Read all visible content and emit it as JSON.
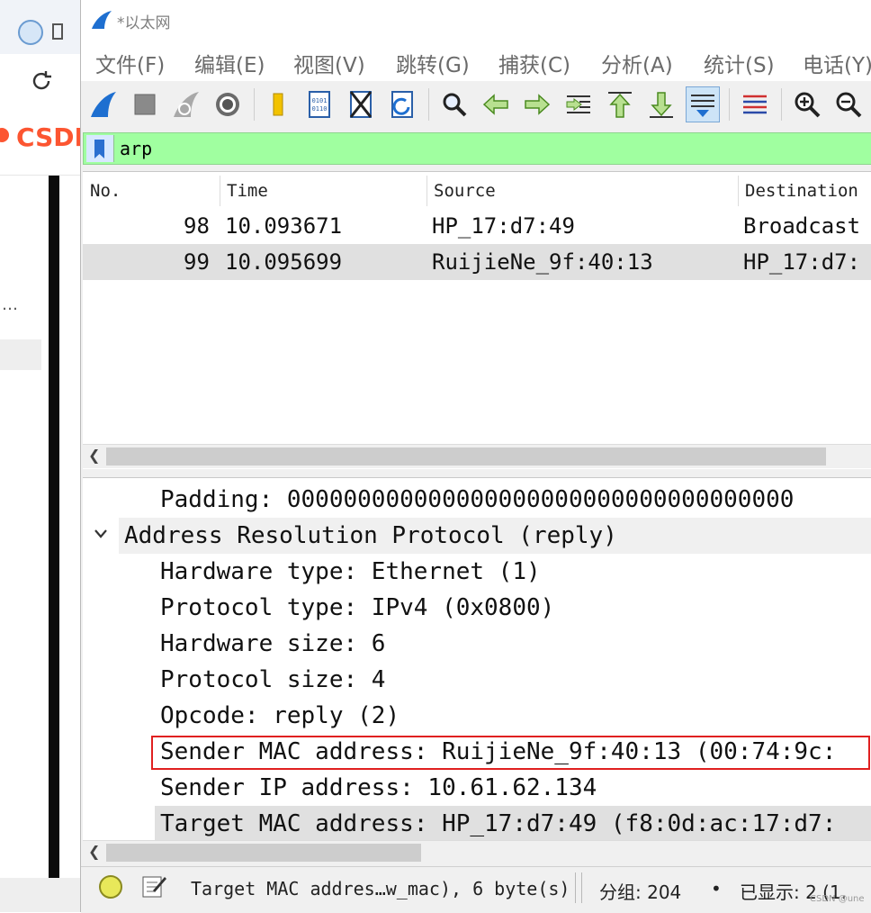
{
  "background_window": {
    "brand": "CSDN",
    "ellipsis": "…"
  },
  "window": {
    "title": "*以太网"
  },
  "menu": [
    "文件(F)",
    "编辑(E)",
    "视图(V)",
    "跳转(G)",
    "捕获(C)",
    "分析(A)",
    "统计(S)",
    "电话(Y)"
  ],
  "toolbar_icons": [
    "shark-fin-start-icon",
    "stop-square-icon",
    "shark-fin-restart-icon",
    "gear-icon",
    "folder-icon",
    "file-binary-icon",
    "close-file-icon",
    "reload-file-icon",
    "search-icon",
    "arrow-left-icon",
    "arrow-right-icon",
    "goto-packet-icon",
    "arrow-up-icon",
    "arrow-down-icon",
    "autoscroll-icon",
    "colorize-icon",
    "zoom-in-icon",
    "zoom-out-icon"
  ],
  "filter": {
    "value": "arp"
  },
  "packet_list": {
    "columns": [
      "No.",
      "Time",
      "Source",
      "Destination"
    ],
    "rows": [
      {
        "no": "98",
        "time": "10.093671",
        "source": "HP_17:d7:49",
        "destination": "Broadcast"
      },
      {
        "no": "99",
        "time": "10.095699",
        "source": "RuijieNe_9f:40:13",
        "destination": "HP_17:d7:"
      }
    ]
  },
  "details": {
    "padding": "Padding: 000000000000000000000000000000000000",
    "arp_header": "Address Resolution Protocol (reply)",
    "fields": [
      "Hardware type: Ethernet (1)",
      "Protocol type: IPv4 (0x0800)",
      "Hardware size: 6",
      "Protocol size: 4",
      "Opcode: reply (2)",
      "Sender MAC address: RuijieNe_9f:40:13 (00:74:9c:",
      "Sender IP address: 10.61.62.134",
      "Target MAC address: HP_17:d7:49 (f8:0d:ac:17:d7:"
    ]
  },
  "status": {
    "field_text": "Target MAC addres…w_mac), 6 byte(s)",
    "packets": "分组: 204",
    "bullet": "•",
    "displayed": "已显示: 2 (1.",
    "watermark": "CSDN @une"
  },
  "colors": {
    "filter_bg": "#a0ffa0",
    "selected_row": "#e0e0e0",
    "highlight_box": "#e02020",
    "title_icon": "#1e6fd0"
  }
}
